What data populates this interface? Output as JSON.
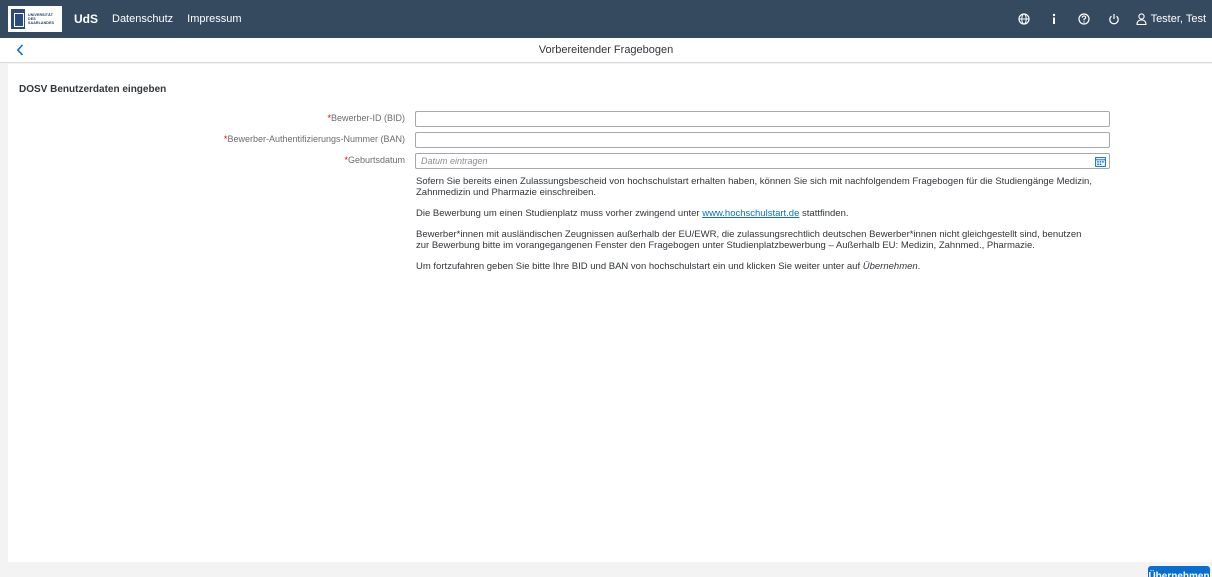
{
  "header": {
    "logo_lines": [
      "UNIVERSITÄT",
      "DES",
      "SAARLANDES"
    ],
    "nav": [
      {
        "label": "UdS"
      },
      {
        "label": "Datenschutz"
      },
      {
        "label": "Impressum"
      }
    ],
    "icons": [
      "globe-icon",
      "info-icon",
      "help-icon",
      "power-icon",
      "user-icon"
    ],
    "user_name": "Tester, Test",
    "bg_color": "#354a5f"
  },
  "subheader": {
    "title": "Vorbereitender Fragebogen"
  },
  "form": {
    "section_title": "DOSV Benutzerdaten eingeben",
    "required_mark": "*",
    "fields": [
      {
        "label": "Bewerber-ID (BID)",
        "value": "",
        "placeholder": ""
      },
      {
        "label": "Bewerber-Authentifizierungs-Nummer (BAN)",
        "value": "",
        "placeholder": ""
      },
      {
        "label": "Geburtsdatum",
        "value": "",
        "placeholder": "Datum eintragen"
      }
    ]
  },
  "info": {
    "p1": "Sofern Sie bereits einen Zulassungsbescheid von hochschulstart erhalten haben, können Sie sich mit nachfolgendem Fragebogen für die Studiengänge Medizin, Zahnmedizin und Pharmazie einschreiben.",
    "p2_before": "Die Bewerbung um einen Studienplatz muss vorher zwingend unter ",
    "p2_link": "www.hochschulstart.de",
    "p2_after": " stattfinden.",
    "p3": "Bewerber*innen mit ausländischen Zeugnissen außerhalb der EU/EWR, die zulassungsrechtlich deutschen Bewerber*innen nicht gleichgestellt sind, benutzen zur Bewerbung bitte im vorangegangenen Fenster den Fragebogen unter Studienplatzbewerbung – Außerhalb EU: Medizin, Zahnmed., Pharmazie.",
    "p4_before": "Um fortzufahren geben Sie bitte Ihre BID und BAN von hochschulstart ein und klicken Sie weiter unter auf ",
    "p4_em": "Übernehmen",
    "p4_after": "."
  },
  "footer": {
    "submit_label": "Übernehmen",
    "accent": "#0a6ed1"
  }
}
